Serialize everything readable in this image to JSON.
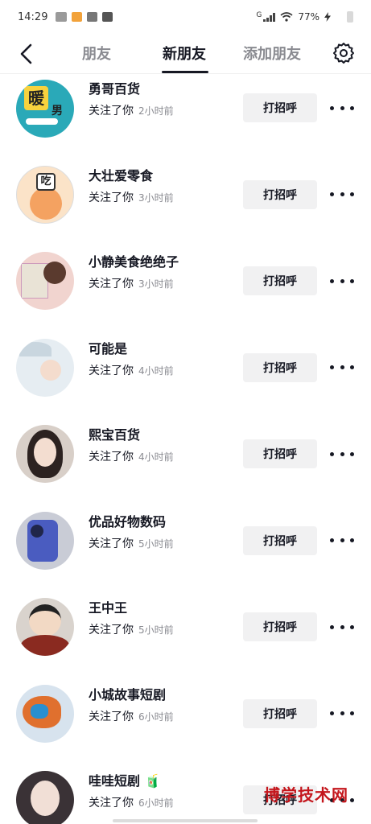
{
  "status_bar": {
    "time": "14:29",
    "network": "G",
    "battery": "77%",
    "icons": [
      "notification-icon",
      "heart-app-icon",
      "weibo-icon",
      "taobao-icon"
    ]
  },
  "header": {
    "tabs": [
      {
        "label": "朋友",
        "active": false
      },
      {
        "label": "新朋友",
        "active": true
      },
      {
        "label": "添加朋友",
        "active": false
      }
    ]
  },
  "followers": [
    {
      "name": "勇哥百货",
      "status": "关注了你",
      "time": "2小时前",
      "avatar_text": "暖",
      "avatar_text2": "男",
      "avatar_bg": "#2aa9b8",
      "action": "打招呼"
    },
    {
      "name": "大壮爱零食",
      "status": "关注了你",
      "time": "3小时前",
      "avatar_text": "吃",
      "avatar_bg": "#fbe3c8",
      "action": "打招呼"
    },
    {
      "name": "小静美食绝绝子",
      "status": "关注了你",
      "time": "3小时前",
      "avatar_bg": "#f1d4cf",
      "action": "打招呼"
    },
    {
      "name": "可能是",
      "status": "关注了你",
      "time": "4小时前",
      "avatar_bg": "#e6edf2",
      "action": "打招呼"
    },
    {
      "name": "熙宝百货",
      "status": "关注了你",
      "time": "4小时前",
      "avatar_bg": "#d8cfc8",
      "action": "打招呼"
    },
    {
      "name": "优品好物数码",
      "status": "关注了你",
      "time": "5小时前",
      "avatar_bg": "#c9ccd6",
      "action": "打招呼"
    },
    {
      "name": "王中王",
      "status": "关注了你",
      "time": "5小时前",
      "avatar_bg": "#d9d3cd",
      "action": "打招呼"
    },
    {
      "name": "小城故事短剧",
      "status": "关注了你",
      "time": "6小时前",
      "avatar_bg": "#d7e3ee",
      "action": "打招呼"
    },
    {
      "name": "哇哇短剧",
      "status": "关注了你",
      "time": "6小时前",
      "avatar_bg": "#3a3236",
      "action": "打招呼",
      "emoji": "🧃"
    }
  ],
  "watermark": "博学技术网"
}
